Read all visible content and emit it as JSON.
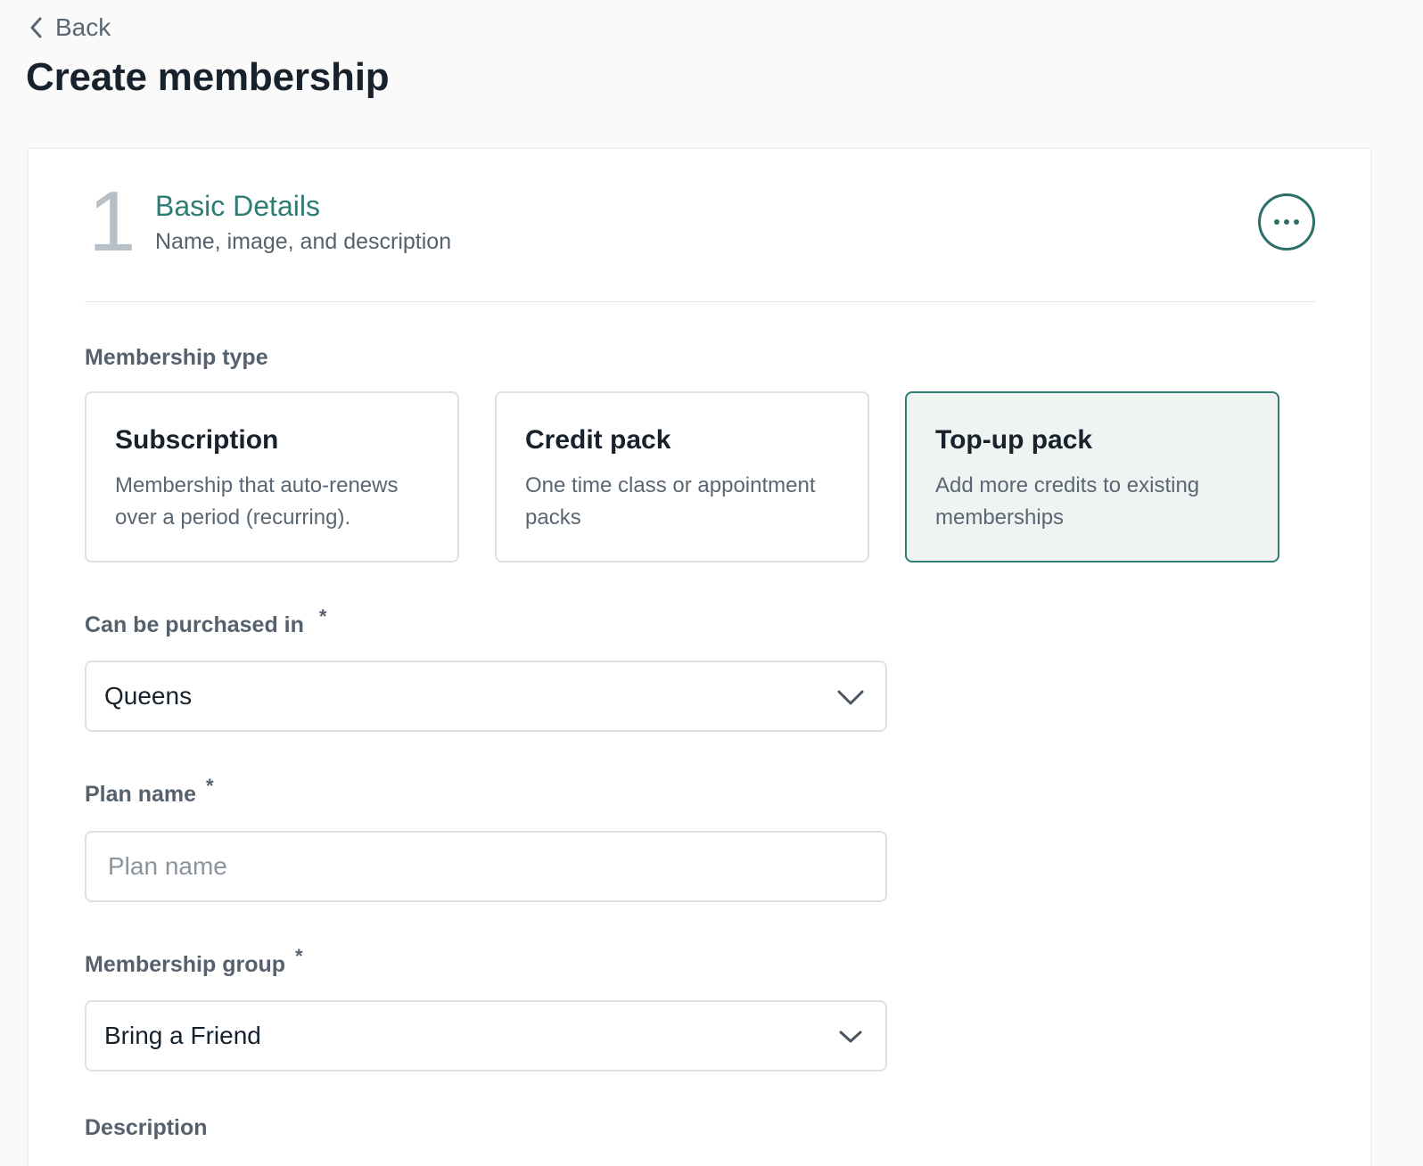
{
  "header": {
    "back_label": "Back",
    "page_title": "Create membership"
  },
  "section": {
    "step_number": "1",
    "title": "Basic Details",
    "subtitle": "Name, image, and description"
  },
  "membership_type": {
    "label": "Membership type",
    "options": [
      {
        "title": "Subscription",
        "description": "Membership that auto-renews over a period (recurring).",
        "selected": false
      },
      {
        "title": "Credit pack",
        "description": "One time class or appointment packs",
        "selected": false
      },
      {
        "title": "Top-up pack",
        "description": "Add more credits to existing memberships",
        "selected": true
      }
    ]
  },
  "purchase_location": {
    "label": "Can be purchased in",
    "required_mark": "*",
    "value": "Queens"
  },
  "plan_name": {
    "label": "Plan name",
    "required_mark": "*",
    "value": "",
    "placeholder": "Plan name"
  },
  "membership_group": {
    "label": "Membership group",
    "required_mark": "*",
    "value": "Bring a Friend"
  },
  "description": {
    "label": "Description"
  },
  "colors": {
    "accent": "#2e7d74",
    "selected_bg": "#eff4f3",
    "border": "#dde1e5"
  },
  "icons": {
    "back": "chevron-left-icon",
    "more": "more-horizontal-icon",
    "dropdown": "chevron-down-icon"
  }
}
